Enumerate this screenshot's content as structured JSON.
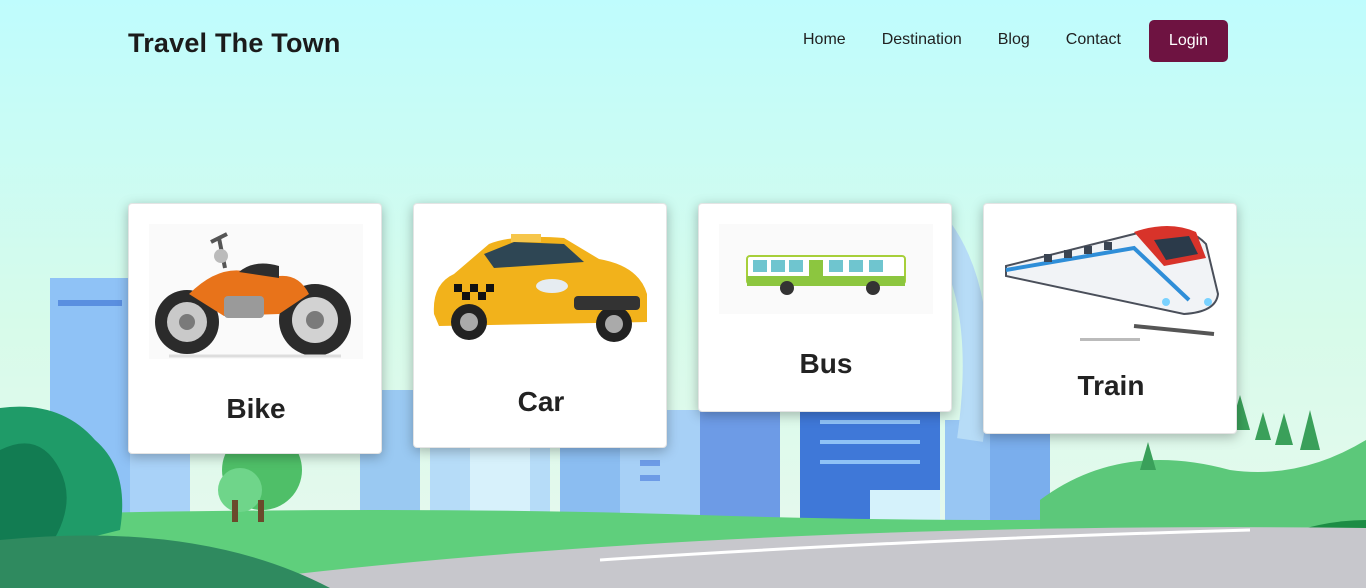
{
  "brand": "Travel The Town",
  "nav": {
    "items": [
      {
        "label": "Home"
      },
      {
        "label": "Destination"
      },
      {
        "label": "Blog"
      },
      {
        "label": "Contact"
      }
    ],
    "login_label": "Login"
  },
  "cards": [
    {
      "title": "Bike",
      "image": "motorcycle-icon"
    },
    {
      "title": "Car",
      "image": "taxi-icon"
    },
    {
      "title": "Bus",
      "image": "bus-icon"
    },
    {
      "title": "Train",
      "image": "train-icon"
    }
  ],
  "colors": {
    "accent": "#6e1341",
    "sky": "#c8fbfb"
  }
}
